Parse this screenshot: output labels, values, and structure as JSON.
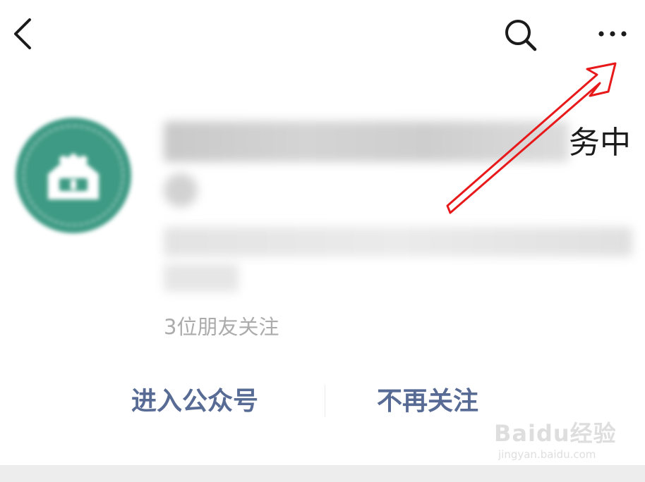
{
  "nav": {
    "back_icon": "chevron-left-icon",
    "search_icon": "search-icon",
    "more_icon": "more-horizontal-icon"
  },
  "account": {
    "avatar_color": "#3e9a84",
    "title_visible_tail": "务中",
    "followers_text": "3位朋友关注"
  },
  "actions": {
    "enter_label": "进入公众号",
    "unfollow_label": "不再关注",
    "link_color": "#576b95"
  },
  "annotation": {
    "arrow_color": "#e8191a"
  },
  "watermark": {
    "logo": "Baidu经验",
    "site": "jingyan.baidu.com"
  }
}
